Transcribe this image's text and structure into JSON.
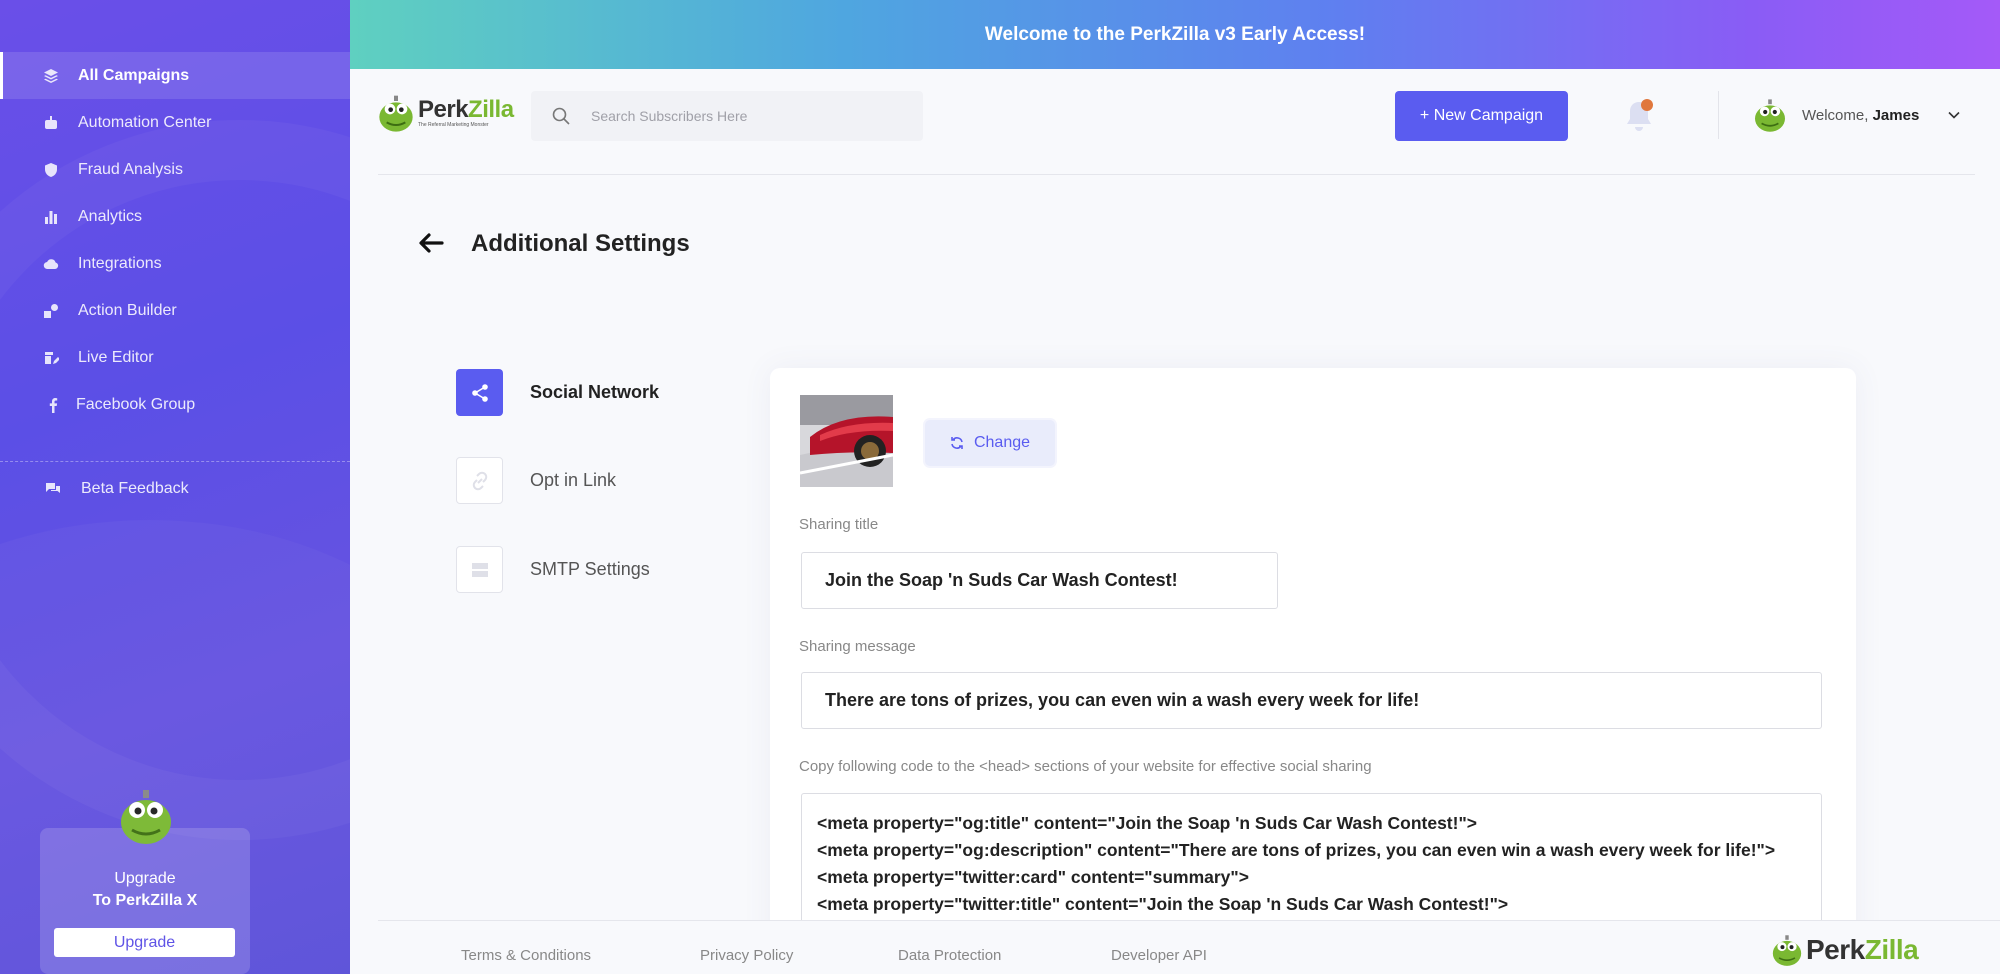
{
  "banner": {
    "text": "Welcome to the PerkZilla v3 Early Access!"
  },
  "sidebar": {
    "items": [
      {
        "label": "All Campaigns",
        "icon": "layers-icon",
        "active": true
      },
      {
        "label": "Automation Center",
        "icon": "robot-icon"
      },
      {
        "label": "Fraud Analysis",
        "icon": "shield-icon"
      },
      {
        "label": "Analytics",
        "icon": "bar-chart-icon"
      },
      {
        "label": "Integrations",
        "icon": "cloud-icon"
      },
      {
        "label": "Action Builder",
        "icon": "shapes-icon"
      },
      {
        "label": "Live Editor",
        "icon": "edit-icon"
      },
      {
        "label": "Facebook Group",
        "icon": "facebook-icon"
      }
    ],
    "feedback": {
      "label": "Beta Feedback",
      "icon": "comments-icon"
    },
    "upgrade": {
      "line1": "Upgrade",
      "line2": "To PerkZilla X",
      "button": "Upgrade"
    }
  },
  "header": {
    "logo": {
      "part1": "Perk",
      "part2": "Zilla",
      "tagline": "The Referral Marketing Monster"
    },
    "search_placeholder": "Search Subscribers Here",
    "new_campaign": "+ New Campaign",
    "user": {
      "welcome": "Welcome,",
      "name": "James"
    }
  },
  "page": {
    "title": "Additional Settings"
  },
  "tabs": [
    {
      "label": "Social Network",
      "icon": "share-icon",
      "active": true
    },
    {
      "label": "Opt in Link",
      "icon": "link-icon"
    },
    {
      "label": "SMTP Settings",
      "icon": "server-icon"
    }
  ],
  "form": {
    "change_button": "Change",
    "sharing_title_label": "Sharing title",
    "sharing_title_value": "Join the Soap 'n Suds Car Wash Contest!",
    "sharing_message_label": "Sharing message",
    "sharing_message_value": "There are tons of prizes, you can even win a wash every week for life!",
    "code_label": "Copy following code to the <head> sections of your website for effective social sharing",
    "code_lines": [
      "<meta property=\"og:title\" content=\"Join the Soap 'n Suds Car Wash Contest!\">",
      "<meta property=\"og:description\" content=\"There are tons of prizes, you can even win a wash every week for life!\">",
      "<meta property=\"twitter:card\" content=\"summary\">",
      "<meta property=\"twitter:title\" content=\"Join the Soap 'n Suds Car Wash Contest!\">"
    ]
  },
  "footer": {
    "links": [
      "Terms & Conditions",
      "Privacy Policy",
      "Data Protection",
      "Developer API"
    ],
    "logo": {
      "part1": "Perk",
      "part2": "Zilla"
    }
  },
  "colors": {
    "accent": "#5a5cf0",
    "brand_green": "#7ab832",
    "notification": "#e0773d"
  }
}
